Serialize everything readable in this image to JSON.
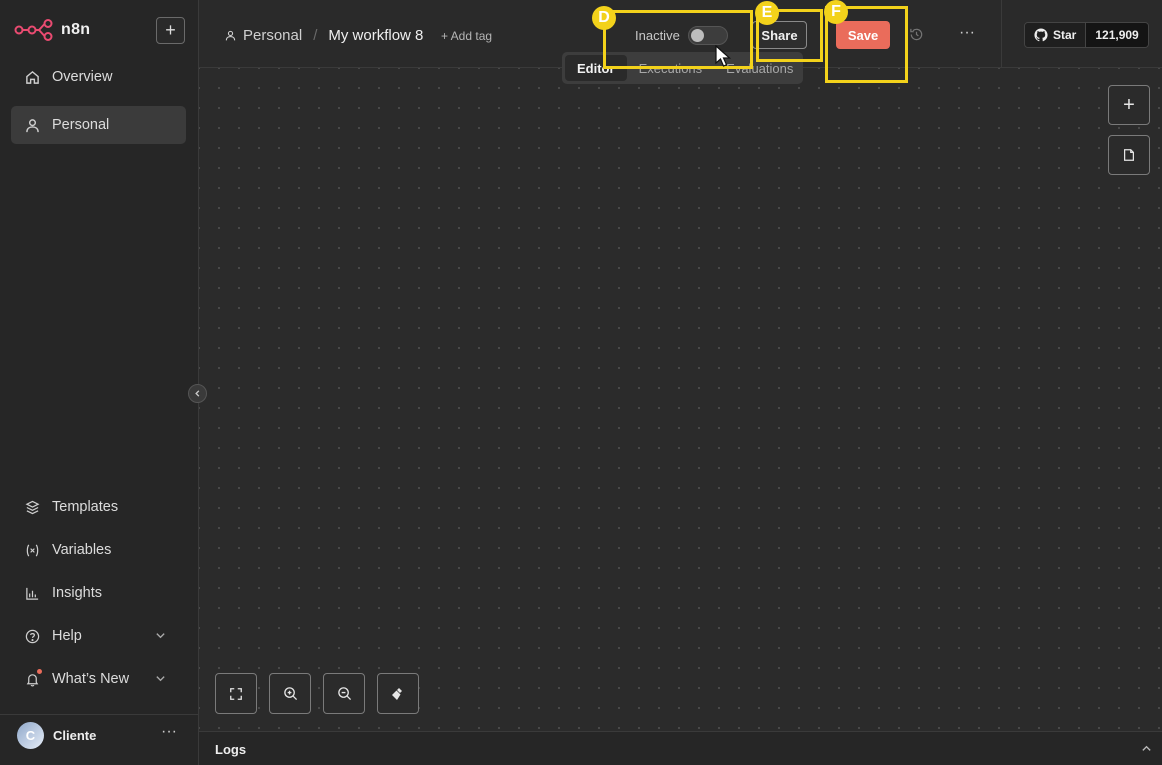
{
  "app": {
    "name": "n8n"
  },
  "sidebar": {
    "items": [
      {
        "label": "Overview",
        "icon": "home-icon"
      },
      {
        "label": "Personal",
        "icon": "user-icon"
      }
    ],
    "bottom_items": [
      {
        "label": "Templates",
        "icon": "box-icon"
      },
      {
        "label": "Variables",
        "icon": "variable-icon"
      },
      {
        "label": "Insights",
        "icon": "bar-chart-icon"
      },
      {
        "label": "Help",
        "icon": "help-icon"
      },
      {
        "label": "What’s New",
        "icon": "bell-icon"
      }
    ],
    "user": {
      "initial": "C",
      "name": "Cliente"
    }
  },
  "header": {
    "project": "Personal",
    "separator": "/",
    "workflow_name": "My workflow 8",
    "add_tag": "+ Add tag",
    "status_label": "Inactive",
    "share_label": "Share",
    "save_label": "Save",
    "github": {
      "star_label": "Star",
      "count": "121,909"
    }
  },
  "tabs": [
    {
      "label": "Editor",
      "active": true
    },
    {
      "label": "Executions",
      "active": false
    },
    {
      "label": "Evaluations",
      "active": false
    }
  ],
  "logs": {
    "title": "Logs"
  },
  "annotations": [
    {
      "label": "D"
    },
    {
      "label": "E"
    },
    {
      "label": "F"
    }
  ],
  "colors": {
    "accent": "#ea6c5b",
    "annotation": "#f3d21b",
    "background": "#2b2b2b",
    "sidebar": "#262626"
  }
}
